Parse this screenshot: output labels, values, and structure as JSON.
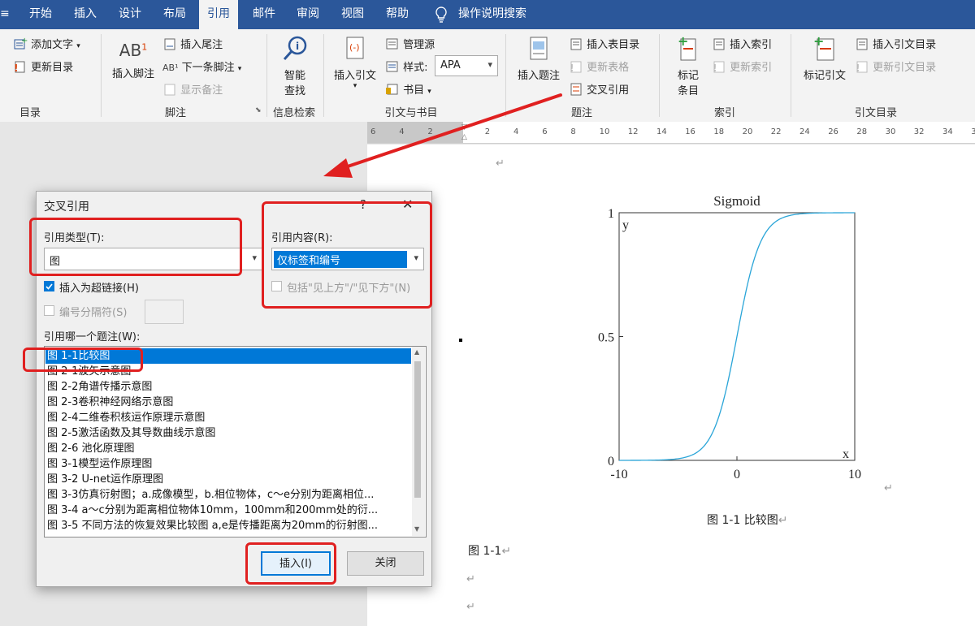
{
  "tabs": {
    "items": [
      "开始",
      "插入",
      "设计",
      "布局",
      "引用",
      "邮件",
      "审阅",
      "视图",
      "帮助"
    ],
    "active": "引用",
    "tell_me": "操作说明搜索"
  },
  "ribbon": {
    "toc": {
      "add_text": "添加文字",
      "update_toc": "更新目录",
      "label": "目录"
    },
    "footnotes": {
      "insert_footnote": "插入脚注",
      "insert_endnote": "插入尾注",
      "next_footnote": "下一条脚注",
      "show_notes": "显示备注",
      "label": "脚注",
      "ab_glyph": "AB",
      "sup": "1"
    },
    "research": {
      "smart_lookup_line1": "智能",
      "smart_lookup_line2": "查找",
      "label": "信息检索"
    },
    "citations": {
      "insert_citation": "插入引文",
      "manage_sources": "管理源",
      "style_label": "样式:",
      "style_value": "APA",
      "bibliography": "书目",
      "label": "引文与书目"
    },
    "captions": {
      "insert_caption": "插入题注",
      "insert_table_of_figures": "插入表目录",
      "update_table": "更新表格",
      "cross_reference": "交叉引用",
      "label": "题注"
    },
    "index": {
      "mark_entry_line1": "标记",
      "mark_entry_line2": "条目",
      "insert_index": "插入索引",
      "update_index": "更新索引",
      "label": "索引"
    },
    "toa": {
      "mark_citation": "标记引文",
      "insert_toa": "插入引文目录",
      "update_toa": "更新引文目录",
      "label": "引文目录"
    }
  },
  "ruler": {
    "numbers": [
      "6",
      "4",
      "2",
      "",
      "2",
      "4",
      "6",
      "8",
      "10",
      "12",
      "14",
      "16",
      "18",
      "20",
      "22",
      "24",
      "26",
      "28",
      "30",
      "32",
      "34",
      "36"
    ]
  },
  "dialog": {
    "title": "交叉引用",
    "help": "?",
    "close": "✕",
    "ref_type_label": "引用类型(T):",
    "ref_type_value": "图",
    "ref_content_label": "引用内容(R):",
    "ref_content_value": "仅标签和编号",
    "hyperlink_label": "插入为超链接(H)",
    "hyperlink_checked": true,
    "above_below_label": "包括\"见上方\"/\"见下方\"(N)",
    "separator_label": "编号分隔符(S)",
    "which_caption_label": "引用哪一个题注(W):",
    "captions": [
      "图 1-1比较图",
      "图 2-1波矢示意图",
      "图 2-2角谱传播示意图",
      "图 2-3卷积神经网络示意图",
      "图 2-4二维卷积核运作原理示意图",
      "图 2-5激活函数及其导数曲线示意图",
      "图 2-6 池化原理图",
      "图 3-1模型运作原理图",
      "图 3-2 U-net运作原理图",
      "图 3-3仿真衍射图；a.成像模型，b.相位物体，c～e分别为距离相位...",
      "图 3-4 a～c分别为距离相位物体10mm，100mm和200mm处的衍...",
      "图 3-5 不同方法的恢复效果比较图 a,e是传播距离为20mm的衍射图..."
    ],
    "selected_index": 0,
    "insert_button": "插入(I)",
    "close_button": "关闭"
  },
  "document": {
    "chart_data": {
      "type": "line",
      "title": "Sigmoid",
      "xlabel": "x",
      "ylabel": "y",
      "xlim": [
        -10,
        10
      ],
      "ylim": [
        0,
        1
      ],
      "xticks": [
        "-10",
        "0",
        "10"
      ],
      "yticks": [
        "0",
        "0.5",
        "1"
      ],
      "function": "1/(1+exp(-x))",
      "line_color": "#2aa5d8",
      "grid": false
    },
    "caption": "图 1-1 比较图",
    "inserted_ref": "图 1-1",
    "para_mark": "↵"
  },
  "colors": {
    "tabbar": "#2b579a",
    "annotation_red": "#e02020",
    "selection_blue": "#0078d7"
  }
}
